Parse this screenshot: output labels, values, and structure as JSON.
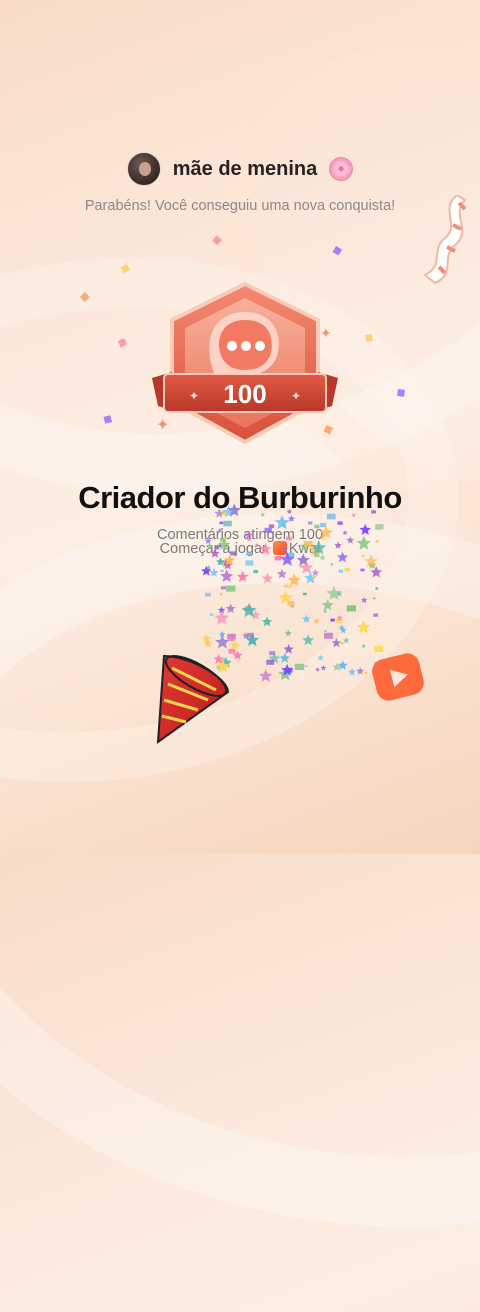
{
  "header": {
    "username": "mãe de menina",
    "username_emoji": "🌸"
  },
  "subtitle": "Parabéns! Você conseguiu uma nova conquista!",
  "badge": {
    "count": "100",
    "icon": "comment-bubble-icon"
  },
  "achievement": {
    "title": "Criador do Burburinho",
    "description": "Comentários atingem 100",
    "cta_prefix": "Começar a jogar",
    "cta_app": "Kwai"
  },
  "colors": {
    "badge_primary": "#e8604a",
    "badge_dark": "#c8412f",
    "badge_light": "#f6a58f",
    "accent_orange": "#ff6a3d"
  }
}
